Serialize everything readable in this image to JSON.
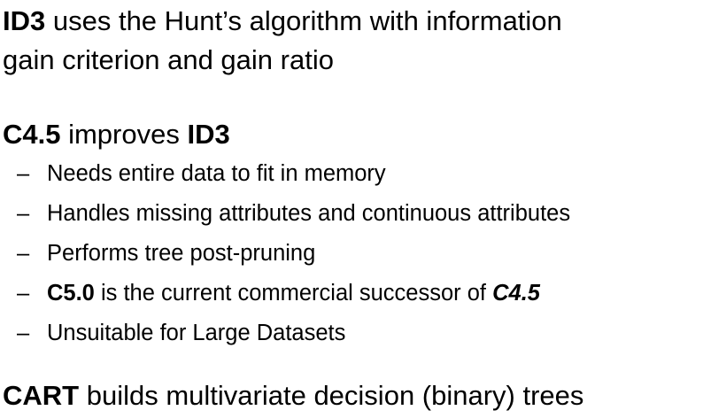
{
  "slide": {
    "p1": {
      "bold": "ID3",
      "text_line1": " uses the Hunt’s algorithm with information",
      "text_line2": "gain criterion and gain ratio"
    },
    "p2": {
      "bold1": "C4.5",
      "mid": " improves ",
      "bold2": "ID3"
    },
    "bullets": [
      {
        "dash": "–",
        "text": "Needs entire data to fit in memory"
      },
      {
        "dash": "–",
        "text": "Handles missing attributes and continuous attributes"
      },
      {
        "dash": "–",
        "text": "Performs tree post-pruning"
      },
      {
        "dash": "–",
        "bold": "C5.0",
        "text": " is the current commercial successor of ",
        "bold_italic": "C4.5"
      },
      {
        "dash": "–",
        "text": "Unsuitable for Large Datasets"
      }
    ],
    "p3": {
      "bold": "CART",
      "text": " builds multivariate decision (binary) trees"
    }
  }
}
